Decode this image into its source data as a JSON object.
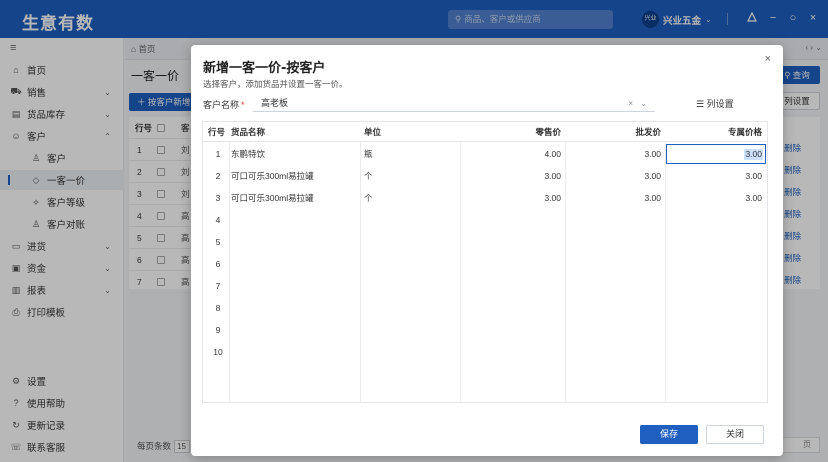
{
  "app": {
    "logo": "生意有数",
    "search_placeholder": "商品、客户或供应商",
    "company_badge": "兴业",
    "company_name": "兴业五金",
    "accent_color": "#1f5fbf"
  },
  "sidebar": {
    "items": [
      {
        "label": "首页",
        "icon": "home-icon"
      },
      {
        "label": "销售",
        "icon": "cart-icon",
        "arrow": "⌄"
      },
      {
        "label": "货品库存",
        "icon": "inventory-icon",
        "arrow": "⌄"
      },
      {
        "label": "客户",
        "icon": "users-icon",
        "arrow": "⌃"
      },
      {
        "label": "客户",
        "icon": "user-icon",
        "sub": true
      },
      {
        "label": "一客一价",
        "icon": "tag-icon",
        "sub": true,
        "active": true
      },
      {
        "label": "客户等级",
        "icon": "level-icon",
        "sub": true
      },
      {
        "label": "客户对账",
        "icon": "reconcile-icon",
        "sub": true
      },
      {
        "label": "进货",
        "icon": "truck-icon",
        "arrow": "⌄"
      },
      {
        "label": "资金",
        "icon": "wallet-icon",
        "arrow": "⌄"
      },
      {
        "label": "报表",
        "icon": "report-icon",
        "arrow": "⌄"
      },
      {
        "label": "打印模板",
        "icon": "printer-icon"
      }
    ],
    "bottom": [
      {
        "label": "设置",
        "icon": "settings-icon"
      },
      {
        "label": "使用帮助",
        "icon": "help-icon"
      },
      {
        "label": "更新记录",
        "icon": "history-icon"
      },
      {
        "label": "联系客服",
        "icon": "chat-icon"
      }
    ]
  },
  "background": {
    "tab_home": "首页",
    "page_title": "一客一价",
    "add_button": "＋ 按客户新增",
    "query_button": "查询",
    "colset_button": "列设置",
    "col_rownum": "行号",
    "col_customer_partial": "客",
    "rows": [
      {
        "n": "1",
        "c": "刘"
      },
      {
        "n": "2",
        "c": "刘"
      },
      {
        "n": "3",
        "c": "刘"
      },
      {
        "n": "4",
        "c": "高"
      },
      {
        "n": "5",
        "c": "高"
      },
      {
        "n": "6",
        "c": "高"
      },
      {
        "n": "7",
        "c": "高"
      }
    ],
    "delete_label": "删除",
    "pager_label": "每页条数",
    "pager_value": "15",
    "pager_right": "页"
  },
  "dialog": {
    "title": "新增一客一价-按客户",
    "subtitle": "选择客户，添加货品并设置一客一价。",
    "customer_label": "客户名称",
    "required_mark": "*",
    "customer_value": "高老板",
    "column_settings": "列设置",
    "columns": {
      "rownum": "行号",
      "name": "货品名称",
      "unit": "单位",
      "retail": "零售价",
      "wholesale": "批发价",
      "special": "专属价格"
    },
    "rows": [
      {
        "n": "1",
        "name": "东鹏特饮",
        "unit": "瓶",
        "retail": "4.00",
        "wholesale": "3.00",
        "special": "3.00"
      },
      {
        "n": "2",
        "name": "可口可乐300ml易拉罐",
        "unit": "个",
        "retail": "3.00",
        "wholesale": "3.00",
        "special": "3.00"
      },
      {
        "n": "3",
        "name": "可口可乐300ml易拉罐",
        "unit": "个",
        "retail": "3.00",
        "wholesale": "3.00",
        "special": "3.00"
      },
      {
        "n": "4"
      },
      {
        "n": "5"
      },
      {
        "n": "6"
      },
      {
        "n": "7"
      },
      {
        "n": "8"
      },
      {
        "n": "9"
      },
      {
        "n": "10"
      }
    ],
    "save_button": "保存",
    "close_button": "关闭"
  }
}
